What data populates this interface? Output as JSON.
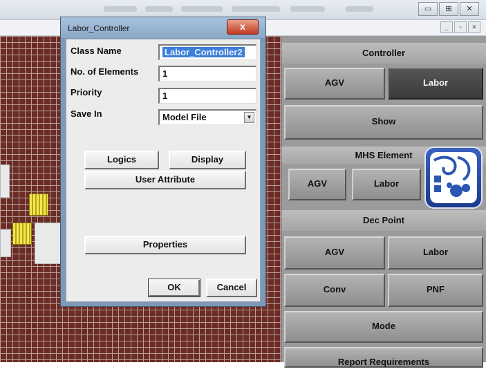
{
  "dialog": {
    "title": "Labor_Controller",
    "close_glyph": "x",
    "fields": {
      "class_name": {
        "label": "Class Name",
        "value": "Labor_Controller2"
      },
      "num_elements": {
        "label": "No. of Elements",
        "value": "1"
      },
      "priority": {
        "label": "Priority",
        "value": "1"
      },
      "save_in": {
        "label": "Save In",
        "value": "Model File"
      }
    },
    "buttons": {
      "logics": "Logics",
      "display": "Display",
      "user_attribute": "User Attribute",
      "properties": "Properties",
      "ok": "OK",
      "cancel": "Cancel"
    }
  },
  "window": {
    "buttons": [
      "▭",
      "⊞",
      "✕"
    ],
    "sub_buttons": [
      "_",
      "▫",
      "✕"
    ]
  },
  "panel": {
    "controller": {
      "header": "Controller",
      "agv": "AGV",
      "labor": "Labor"
    },
    "show": "Show",
    "mhs_element": {
      "header": "MHS Element",
      "agv": "AGV",
      "labor": "Labor"
    },
    "dec_point": {
      "header": "Dec Point",
      "agv": "AGV",
      "labor": "Labor",
      "conv": "Conv",
      "pnf": "PNF"
    },
    "mode": "Mode",
    "report": "Report Requirements"
  },
  "colors": {
    "grid_bg": "#6a2c24",
    "panel_bg": "#9b9b9b",
    "selected_button": "#3f3f3f",
    "selection_highlight": "#3d7fd8",
    "dialog_frame": "#7e99b8"
  },
  "icons": [
    "close-icon",
    "dropdown-arrow-icon",
    "minimize-icon",
    "maximize-icon",
    "app-logo-icon"
  ]
}
